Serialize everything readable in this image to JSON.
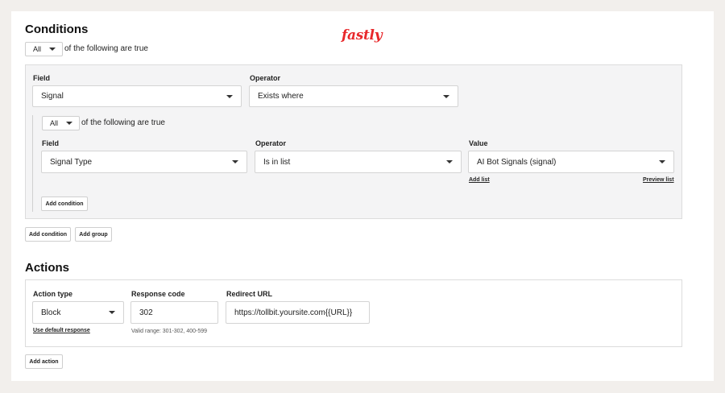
{
  "logo": {
    "text": "fastly",
    "color": "#e8282b"
  },
  "conditions": {
    "title": "Conditions",
    "match_select": "All",
    "match_suffix": "of the following are true",
    "group": {
      "field_label": "Field",
      "field_value": "Signal",
      "operator_label": "Operator",
      "operator_value": "Exists where",
      "nested": {
        "match_select": "All",
        "match_suffix": "of the following are true",
        "field_label": "Field",
        "field_value": "Signal Type",
        "operator_label": "Operator",
        "operator_value": "Is in list",
        "value_label": "Value",
        "value_value": "AI Bot Signals (signal)",
        "add_list": "Add list",
        "preview_list": "Preview list",
        "add_condition": "Add condition"
      }
    },
    "add_condition": "Add condition",
    "add_group": "Add group"
  },
  "actions": {
    "title": "Actions",
    "action_type_label": "Action type",
    "action_type_value": "Block",
    "use_default_response": "Use default response",
    "response_code_label": "Response code",
    "response_code_value": "302",
    "response_code_hint": "Valid range: 301-302, 400-599",
    "redirect_url_label": "Redirect URL",
    "redirect_url_value": "https://tollbit.yoursite.com{{URL}}",
    "add_action": "Add action"
  }
}
